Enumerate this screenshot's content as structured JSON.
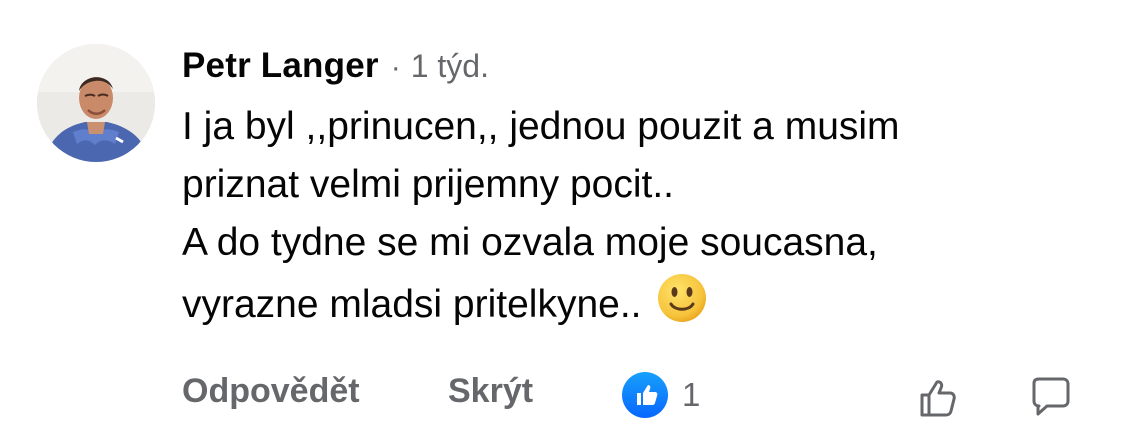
{
  "comment": {
    "author": "Petr Langer",
    "separator": "·",
    "time": "1 týd.",
    "lines": [
      "I ja byl ,,prinucen,, jednou pouzit a musim",
      "priznat velmi prijemny pocit..",
      "A do tydne se mi ozvala moje soucasna,",
      "vyrazne mladsi pritelkyne.."
    ],
    "emoji": "slightly-smiling-face-emoji"
  },
  "actions": {
    "reply_label": "Odpovědět",
    "hide_label": "Skrýt",
    "like_count": "1"
  },
  "colors": {
    "text": "#050505",
    "secondary": "#65676b",
    "like_blue": "#0866ff"
  },
  "icons": {
    "reaction": "like-thumb-icon",
    "like_action": "thumbs-up-outline-icon",
    "comment_action": "comment-bubble-icon"
  }
}
